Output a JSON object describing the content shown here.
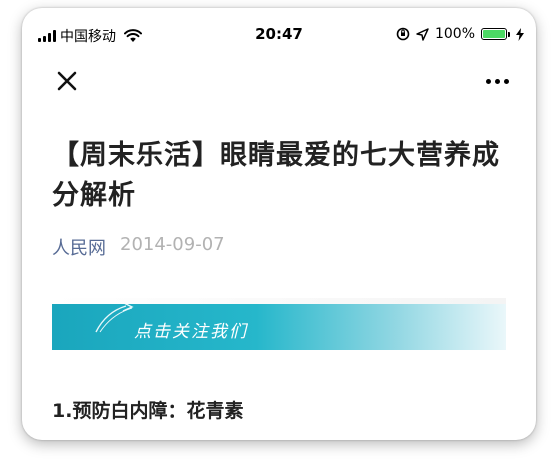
{
  "status_bar": {
    "carrier": "中国移动",
    "time": "20:47",
    "battery": "100%",
    "battery_level": 1.0
  },
  "nav": {
    "close_icon": "close-icon",
    "more_icon": "more-icon"
  },
  "article": {
    "title": "【周末乐活】眼睛最爱的七大营养成分解析",
    "author": "人民网",
    "date": "2014-09-07",
    "banner_text": "点击关注我们",
    "section_heading": "1.预防白内障：花青素"
  },
  "colors": {
    "author": "#576b95",
    "date": "#b2b2b2",
    "banner": "#1aa6bd",
    "battery": "#4cd964"
  }
}
